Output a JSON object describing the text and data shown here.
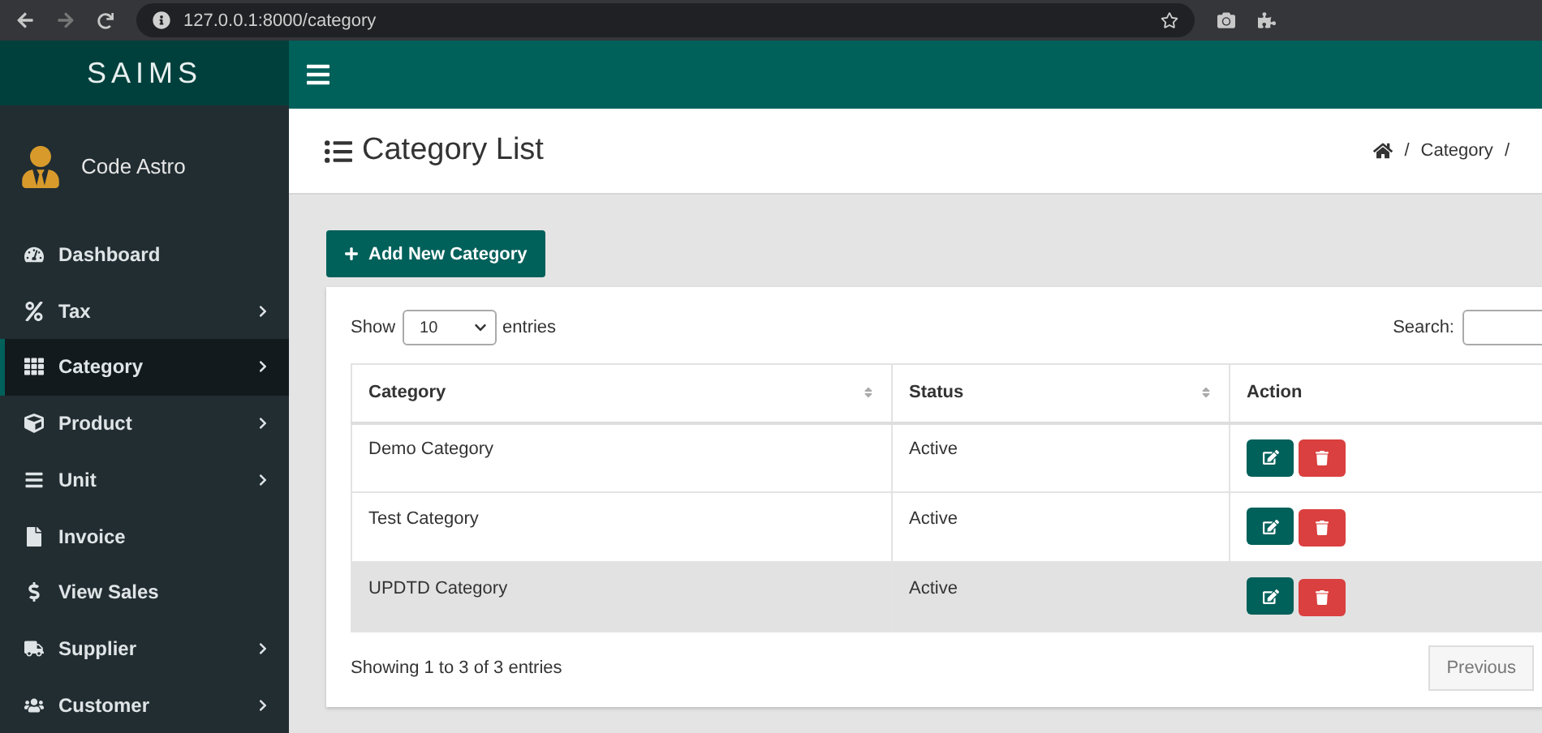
{
  "browser": {
    "url": "127.0.0.1:8000/category"
  },
  "brand": "SAIMS",
  "user": {
    "name": "Code Astro"
  },
  "sidebar": {
    "items": [
      {
        "label": "Dashboard",
        "has_submenu": false,
        "selected": false
      },
      {
        "label": "Tax",
        "has_submenu": true,
        "selected": false
      },
      {
        "label": "Category",
        "has_submenu": true,
        "selected": true
      },
      {
        "label": "Product",
        "has_submenu": true,
        "selected": false
      },
      {
        "label": "Unit",
        "has_submenu": true,
        "selected": false
      },
      {
        "label": "Invoice",
        "has_submenu": false,
        "selected": false
      },
      {
        "label": "View Sales",
        "has_submenu": false,
        "selected": false
      },
      {
        "label": "Supplier",
        "has_submenu": true,
        "selected": false
      },
      {
        "label": "Customer",
        "has_submenu": true,
        "selected": false
      }
    ]
  },
  "page": {
    "title": "Category List",
    "breadcrumb": [
      "/",
      "Category",
      "/"
    ]
  },
  "add_button": "Add New Category",
  "table": {
    "show_label": "Show",
    "page_size": "10",
    "entries_label": "entries",
    "search_label": "Search:",
    "columns": [
      {
        "label": "Category",
        "sortable": true
      },
      {
        "label": "Status",
        "sortable": true
      },
      {
        "label": "Action",
        "sortable": false
      }
    ],
    "rows": [
      {
        "category": "Demo Category",
        "status": "Active",
        "highlighted": false
      },
      {
        "category": "Test Category",
        "status": "Active",
        "highlighted": false
      },
      {
        "category": "UPDTD Category",
        "status": "Active",
        "highlighted": true
      }
    ],
    "info": "Showing 1 to 3 of 3 entries",
    "previous": "Previous"
  }
}
